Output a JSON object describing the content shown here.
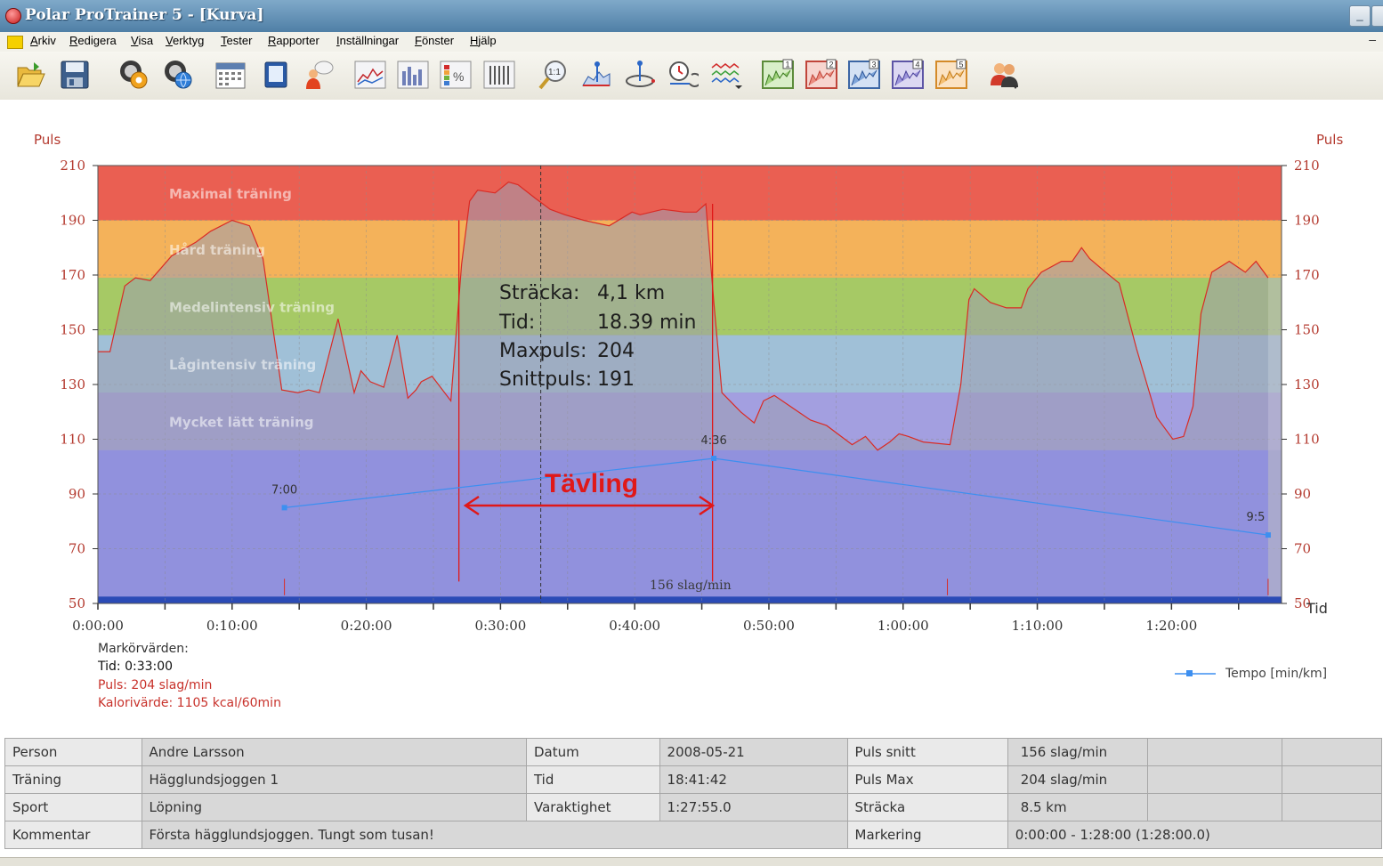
{
  "window": {
    "title": "Polar ProTrainer 5 - [Kurva]"
  },
  "menu": [
    "Arkiv",
    "Redigera",
    "Visa",
    "Verktyg",
    "Tester",
    "Rapporter",
    "Inställningar",
    "Fönster",
    "Hjälp"
  ],
  "toolbar": {
    "icons": [
      "open-folder-icon",
      "save-icon",
      "exercise-gear-icon",
      "exercise-globe-icon",
      "calendar-icon",
      "book-icon",
      "person-comment-icon",
      "curve-chart-icon",
      "bar-chart-icon",
      "percent-chart-icon",
      "list-chart-icon",
      "zoom-1to1-icon",
      "marker-icon",
      "lap-icon",
      "time-lap-icon",
      "compare-icon",
      "sport-chart-1-icon",
      "sport-chart-2-icon",
      "sport-chart-3-icon",
      "sport-chart-4-icon",
      "sport-chart-5-icon",
      "users-icon"
    ],
    "numbered_badges": [
      "1",
      "2",
      "3",
      "4",
      "5"
    ],
    "zoom_label": "1:1"
  },
  "chart_data": {
    "type": "area",
    "ylabel_left": "Puls",
    "ylabel_right": "Puls",
    "xlabel": "Tid",
    "ylim": [
      50,
      210
    ],
    "y_ticks": [
      "210",
      "190",
      "170",
      "150",
      "130",
      "110",
      "90",
      "70",
      "50"
    ],
    "x_ticks": [
      "0:00:00",
      "0:10:00",
      "0:20:00",
      "0:30:00",
      "0:40:00",
      "0:50:00",
      "1:00:00",
      "1:10:00",
      "1:20:00"
    ],
    "xlim_minutes": [
      0,
      88
    ],
    "zones": [
      {
        "name": "Maximal träning",
        "from": 190,
        "to": 210,
        "color": "#ea5f52"
      },
      {
        "name": "Hård träning",
        "from": 169,
        "to": 190,
        "color": "#f4b25a"
      },
      {
        "name": "Medelintensiv träning",
        "from": 148,
        "to": 169,
        "color": "#a6c965"
      },
      {
        "name": "Lågintensiv träning",
        "from": 127,
        "to": 148,
        "color": "#a0c0d7"
      },
      {
        "name": "Mycket lätt träning",
        "from": 106,
        "to": 127,
        "color": "#a39fe0"
      }
    ],
    "series": [
      {
        "name": "Puls",
        "x_minutes": [
          0,
          0.9,
          2,
          2.8,
          3.9,
          5.5,
          7.3,
          8.4,
          10,
          11.3,
          12.3,
          13.7,
          14.9,
          15.7,
          16.5,
          17.9,
          19.1,
          19.6,
          20.3,
          21.3,
          22.3,
          23.1,
          23.7,
          24.1,
          24.9,
          26.3,
          27.1,
          27.7,
          28.3,
          29.6,
          30.6,
          31.3,
          32.6,
          33.7,
          34.8,
          36.2,
          38.1,
          39.8,
          40.4,
          42.1,
          43.7,
          44.6,
          45.3,
          45.9,
          46.5,
          47.9,
          48.9,
          49.6,
          50.4,
          51.6,
          53.1,
          54.3,
          56.2,
          57.2,
          58.1,
          59,
          59.7,
          60.4,
          61.5,
          63.5,
          64.3,
          64.9,
          65.3,
          66.5,
          67.7,
          68.8,
          69.3,
          70.3,
          71.8,
          72.6,
          73.3,
          73.9,
          75.1,
          76.1,
          77.4,
          78.9,
          80.1,
          80.9,
          81.6,
          82.2,
          83,
          84.3,
          85.5,
          86.3,
          87.2
        ],
        "values": [
          142,
          142,
          166,
          169,
          168,
          177,
          182,
          186,
          190,
          188,
          176,
          128,
          127,
          128,
          127,
          154,
          127,
          135,
          131,
          129,
          148,
          125,
          128,
          131,
          133,
          124,
          174,
          197,
          201,
          200,
          204,
          203,
          198,
          194,
          192,
          190,
          188,
          193,
          192,
          194,
          193,
          193,
          196,
          160,
          127,
          120,
          116,
          124,
          126,
          122,
          117,
          115,
          108,
          111,
          106,
          109,
          112,
          111,
          109,
          108,
          130,
          161,
          165,
          160,
          158,
          158,
          165,
          171,
          175,
          175,
          180,
          176,
          171,
          167,
          143,
          118,
          110,
          111,
          122,
          156,
          171,
          175,
          171,
          175,
          169
        ]
      },
      {
        "name": "Tempo [min/km]",
        "x_minutes": [
          13.9,
          45.9,
          87.2
        ],
        "values": [
          85,
          103,
          75
        ],
        "point_labels": [
          "7:00",
          "4:36",
          "9:5"
        ]
      }
    ],
    "mean_label": "156 slag/min",
    "annotation": {
      "rows": [
        {
          "label": "Sträcka:",
          "value": "4,1 km"
        },
        {
          "label": "Tid:",
          "value": "18.39 min"
        },
        {
          "label": "Maxpuls:",
          "value": "204"
        },
        {
          "label": "Snittpuls:",
          "value": "191"
        }
      ],
      "title": "Tävling"
    },
    "markers": {
      "section_start_minutes": 26.9,
      "section_end_minutes": 45.8,
      "cursor_minutes": 33
    },
    "legend": {
      "label": "Tempo [min/km]",
      "placement": "bottom-right"
    }
  },
  "cursor_values": {
    "title": "Markörvärden:",
    "time": "Tid: 0:33:00",
    "pulse": "Puls: 204 slag/min",
    "calories": "Kalorivärde: 1105 kcal/60min"
  },
  "info_table": [
    [
      "Person",
      "Andre Larsson",
      "Datum",
      "2008-05-21",
      "Puls snitt",
      "156 slag/min",
      "",
      ""
    ],
    [
      "Träning",
      "Hägglundsjoggen 1",
      "Tid",
      "18:41:42",
      "Puls Max",
      "204 slag/min",
      "",
      ""
    ],
    [
      "Sport",
      "Löpning",
      "Varaktighet",
      "1:27:55.0",
      "Sträcka",
      "8.5 km",
      "",
      ""
    ],
    [
      "Kommentar",
      "Första hägglundsjoggen. Tungt som tusan!",
      "Markering",
      "0:00:00 - 1:28:00 (1:28:00.0)"
    ]
  ],
  "colors": {
    "pulse_line": "#d92b25",
    "tempo_line": "#3d8ff0",
    "bottom_band": "#2b4bb6",
    "below_zones": "#9191dd",
    "annotation_red": "#e01818",
    "axis_text": "#b43a2f"
  }
}
